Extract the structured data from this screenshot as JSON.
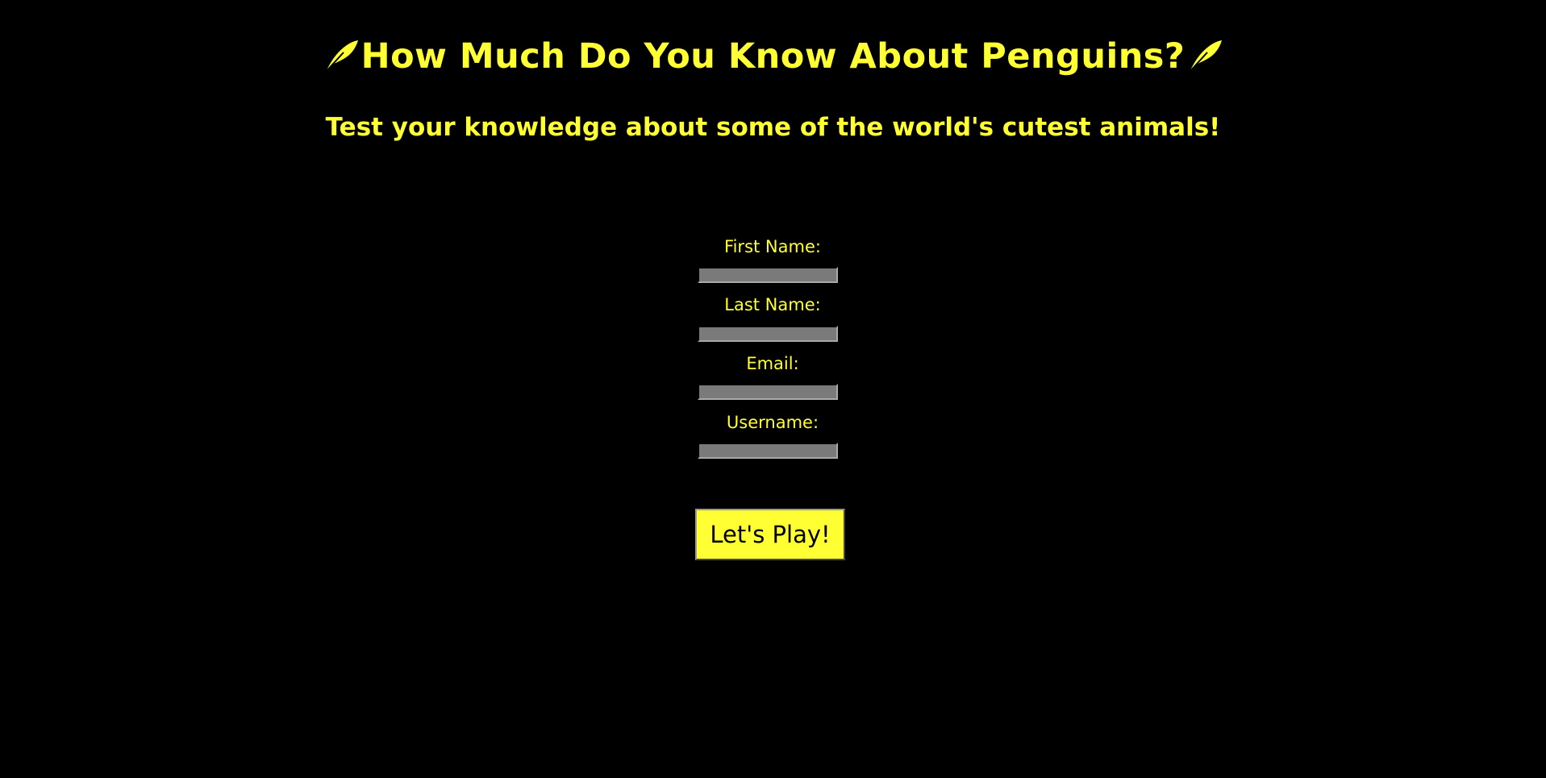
{
  "header": {
    "title": "How Much Do You Know About Penguins?",
    "subtitle": "Test your knowledge about some of the world's cutest animals!",
    "left_icon": "feather-icon",
    "right_icon": "feather-icon"
  },
  "form": {
    "fields": [
      {
        "label": "First Name:",
        "value": ""
      },
      {
        "label": "Last Name:",
        "value": ""
      },
      {
        "label": "Email:",
        "value": ""
      },
      {
        "label": "Username:",
        "value": ""
      }
    ],
    "submit_label": "Let's Play!"
  },
  "colors": {
    "background": "#000000",
    "accent": "#ffff33",
    "input_fill": "#7a7a7a",
    "button_text": "#000000"
  }
}
